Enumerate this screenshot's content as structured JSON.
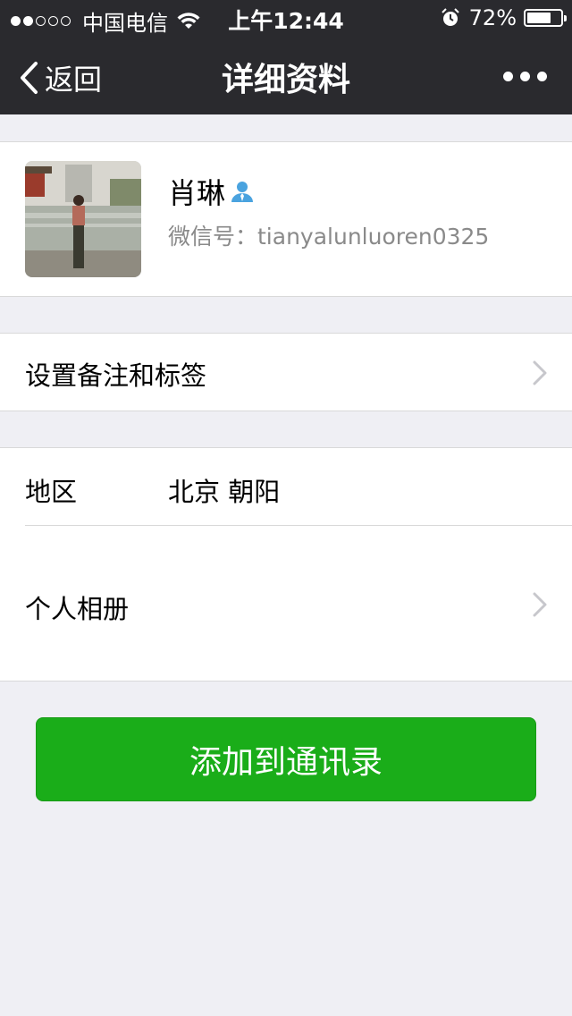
{
  "status_bar": {
    "signal_dots": [
      true,
      true,
      false,
      false,
      false
    ],
    "carrier": "中国电信",
    "time": "上午12:44",
    "battery_percent": "72%",
    "battery_level": 0.72
  },
  "nav": {
    "back_label": "返回",
    "title": "详细资料"
  },
  "profile": {
    "name": "肖琳",
    "wechat_id": "微信号：tianyalunluoren0325"
  },
  "remark_cell": {
    "label": "设置备注和标签"
  },
  "info": {
    "region_label": "地区",
    "region_value": "北京 朝阳",
    "album_label": "个人相册"
  },
  "add_button": {
    "label": "添加到通讯录"
  },
  "colors": {
    "nav_background": "#2a2a2e",
    "page_background": "#efeff4",
    "button_green": "#1aad19",
    "person_icon_blue": "#4aa3df"
  }
}
